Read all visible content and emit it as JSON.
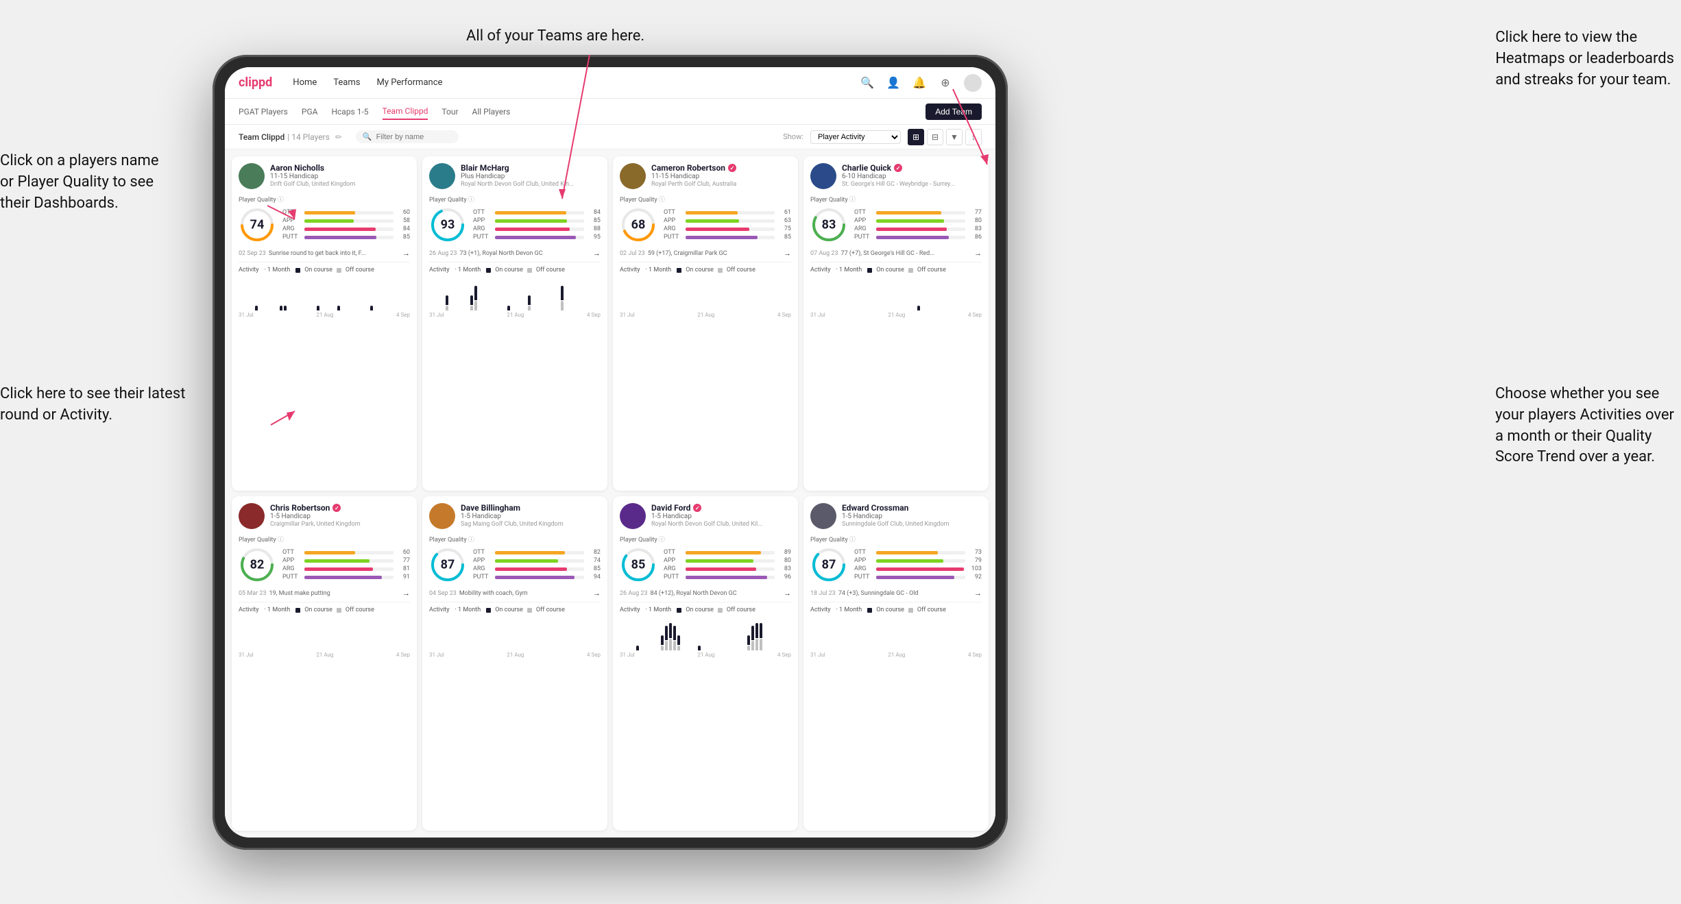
{
  "annotations": {
    "teams_label": "All of your Teams are here.",
    "heatmaps_label": "Click here to view the\nHeatmaps or leaderboards\nand streaks for your team.",
    "players_label": "Click on a players name\nor Player Quality to see\ntheir Dashboards.",
    "round_label": "Click here to see their latest\nround or Activity.",
    "activity_label": "Choose whether you see\nyour players Activities over\na month or their Quality\nScore Trend over a year."
  },
  "nav": {
    "logo": "clippd",
    "items": [
      "Home",
      "Teams",
      "My Performance"
    ],
    "icons": [
      "🔍",
      "👤",
      "🔔",
      "⊕",
      "👤"
    ]
  },
  "sub_nav": {
    "items": [
      "PGAT Players",
      "PGA",
      "Hcaps 1-5",
      "Team Clippd",
      "Tour",
      "All Players"
    ],
    "active": "Team Clippd",
    "add_team_btn": "Add Team"
  },
  "team_header": {
    "title": "Team Clippd",
    "count": "14 Players",
    "search_placeholder": "Filter by name",
    "show_label": "Show:",
    "show_value": "Player Activity",
    "view_modes": [
      "grid4",
      "grid2",
      "filter",
      "sort"
    ]
  },
  "players": [
    {
      "name": "Aaron Nicholls",
      "handicap": "11-15 Handicap",
      "club": "Drift Golf Club, United Kingdom",
      "quality": 74,
      "ott": 60,
      "app": 58,
      "arg": 84,
      "putt": 85,
      "round_date": "02 Sep 23",
      "round_desc": "Sunrise round to get back into it, F...",
      "avatar_color": "av-green"
    },
    {
      "name": "Blair McHarg",
      "handicap": "Plus Handicap",
      "club": "Royal North Devon Golf Club, United Kin...",
      "quality": 93,
      "ott": 84,
      "app": 85,
      "arg": 88,
      "putt": 95,
      "round_date": "26 Aug 23",
      "round_desc": "73 (+1), Royal North Devon GC",
      "avatar_color": "av-teal"
    },
    {
      "name": "Cameron Robertson",
      "handicap": "11-15 Handicap",
      "club": "Royal Perth Golf Club, Australia",
      "quality": 68,
      "ott": 61,
      "app": 63,
      "arg": 75,
      "putt": 85,
      "round_date": "02 Jul 23",
      "round_desc": "59 (+17), Craigmillar Park GC",
      "avatar_color": "av-brown",
      "verified": true
    },
    {
      "name": "Charlie Quick",
      "handicap": "6-10 Handicap",
      "club": "St. George's Hill GC - Weybridge - Surrey...",
      "quality": 83,
      "ott": 77,
      "app": 80,
      "arg": 83,
      "putt": 86,
      "round_date": "07 Aug 23",
      "round_desc": "77 (+7), St George's Hill GC - Red...",
      "avatar_color": "av-blue",
      "verified": true
    },
    {
      "name": "Chris Robertson",
      "handicap": "1-5 Handicap",
      "club": "Craigmillar Park, United Kingdom",
      "quality": 82,
      "ott": 60,
      "app": 77,
      "arg": 81,
      "putt": 91,
      "round_date": "05 Mar 23",
      "round_desc": "19, Must make putting",
      "avatar_color": "av-red",
      "verified": true
    },
    {
      "name": "Dave Billingham",
      "handicap": "1-5 Handicap",
      "club": "Sag Maing Golf Club, United Kingdom",
      "quality": 87,
      "ott": 82,
      "app": 74,
      "arg": 85,
      "putt": 94,
      "round_date": "04 Sep 23",
      "round_desc": "Mobility with coach, Gym",
      "avatar_color": "av-orange"
    },
    {
      "name": "David Ford",
      "handicap": "1-5 Handicap",
      "club": "Royal North Devon Golf Club, United Kil...",
      "quality": 85,
      "ott": 89,
      "app": 80,
      "arg": 83,
      "putt": 96,
      "round_date": "26 Aug 23",
      "round_desc": "84 (+12), Royal North Devon GC",
      "avatar_color": "av-purple",
      "verified": true
    },
    {
      "name": "Edward Crossman",
      "handicap": "1-5 Handicap",
      "club": "Sunningdale Golf Club, United Kingdom",
      "quality": 87,
      "ott": 73,
      "app": 79,
      "arg": 103,
      "putt": 92,
      "round_date": "18 Jul 23",
      "round_desc": "74 (+3), Sunningdale GC - Old",
      "avatar_color": "av-gray"
    }
  ],
  "chart": {
    "activity_label": "Activity",
    "period_label": "· 1 Month",
    "on_course_label": "On course",
    "off_course_label": "Off course",
    "dates": [
      "31 Jul",
      "21 Aug",
      "4 Sep"
    ],
    "on_course_color": "#1a1a2e",
    "off_course_color": "#c0c0c0"
  },
  "bar_colors": {
    "ott": "#f5a623",
    "app": "#7ed321",
    "arg": "#e63b6f",
    "putt": "#9b59b6"
  }
}
